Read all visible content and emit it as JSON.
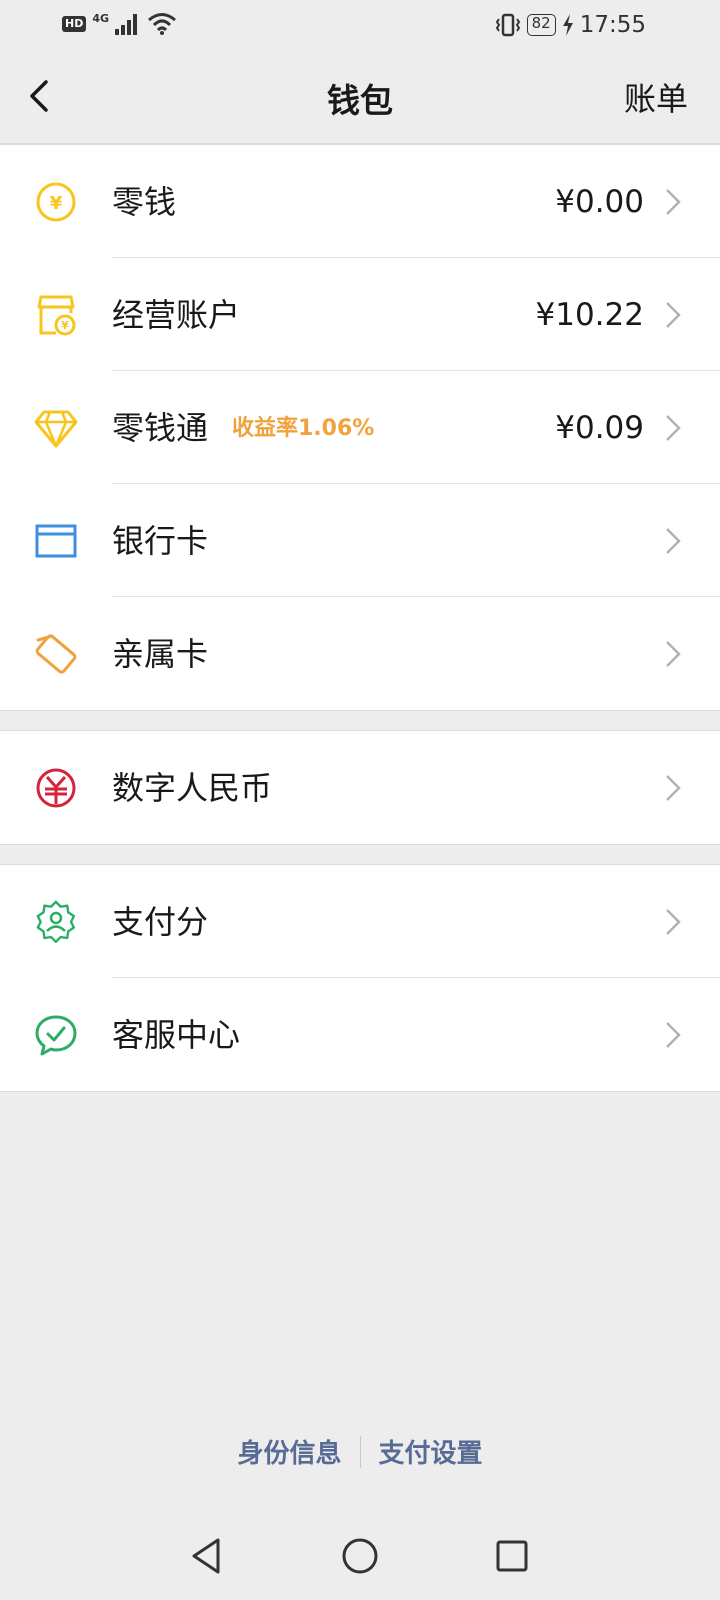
{
  "status_bar": {
    "hd": "HD",
    "network": "4G",
    "battery": "82",
    "time": "17:55"
  },
  "nav": {
    "title": "钱包",
    "right_action": "账单"
  },
  "groups": [
    {
      "items": [
        {
          "label": "零钱",
          "value": "¥0.00",
          "icon": "coin-icon",
          "color": "#f7c51c"
        },
        {
          "label": "经营账户",
          "value": "¥10.22",
          "icon": "store-icon",
          "color": "#f7c51c"
        },
        {
          "label": "零钱通",
          "badge": "收益率1.06%",
          "value": "¥0.09",
          "icon": "diamond-icon",
          "color": "#f7c51c"
        },
        {
          "label": "银行卡",
          "value": "",
          "icon": "bank-card-icon",
          "color": "#3d8fe0"
        },
        {
          "label": "亲属卡",
          "value": "",
          "icon": "family-card-icon",
          "color": "#f2a23c"
        }
      ]
    },
    {
      "items": [
        {
          "label": "数字人民币",
          "value": "",
          "icon": "digital-rmb-icon",
          "color": "#d4233a"
        }
      ]
    },
    {
      "items": [
        {
          "label": "支付分",
          "value": "",
          "icon": "pay-score-icon",
          "color": "#2aae67"
        },
        {
          "label": "客服中心",
          "value": "",
          "icon": "customer-service-icon",
          "color": "#2aae67"
        }
      ]
    }
  ],
  "footer": {
    "identity": "身份信息",
    "pay_settings": "支付设置"
  },
  "colors": {
    "background": "#ededed",
    "link": "#576b95",
    "badge": "#f2a23c"
  }
}
